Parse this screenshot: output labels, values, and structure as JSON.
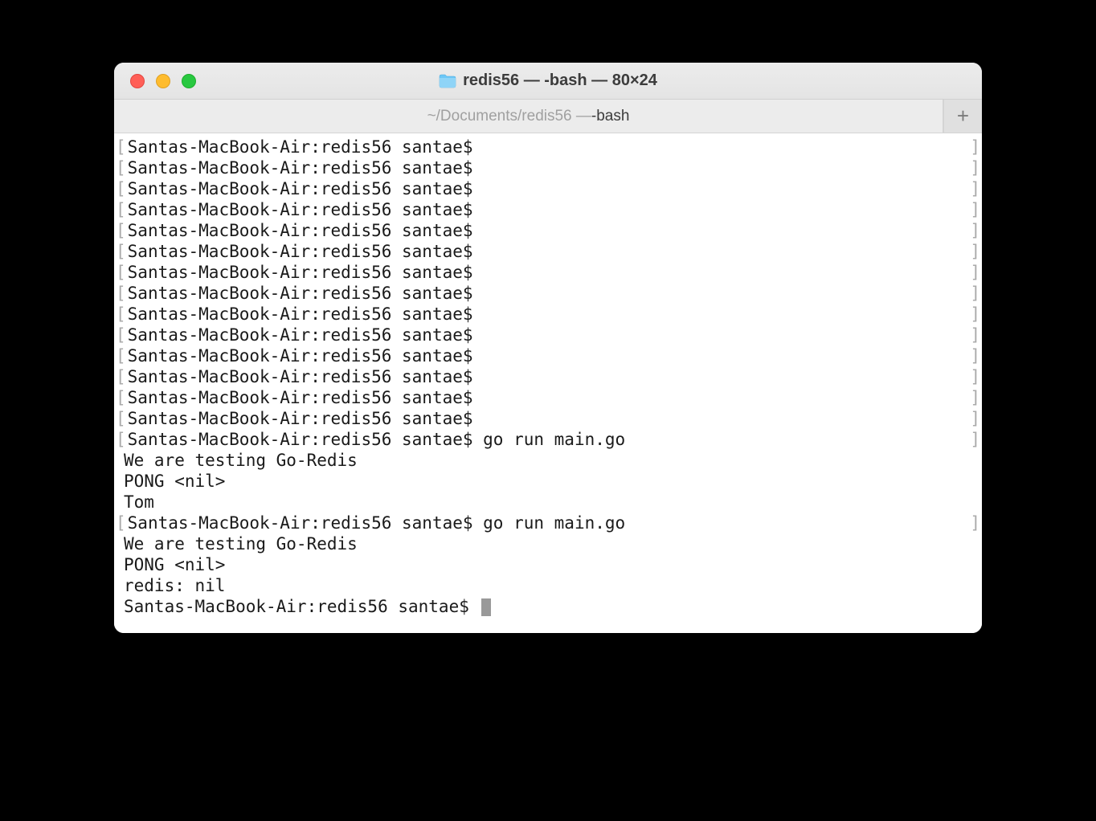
{
  "window": {
    "title": "redis56 — -bash — 80×24",
    "tab_path": "~/Documents/redis56 — ",
    "tab_shell": "-bash"
  },
  "terminal": {
    "prompt": "Santas-MacBook-Air:redis56 santae$ ",
    "empty_prompt_count": 14,
    "run1": {
      "cmd": "go run main.go",
      "out": [
        "We are testing Go-Redis",
        "PONG <nil>",
        "Tom"
      ]
    },
    "run2": {
      "cmd": "go run main.go",
      "out": [
        "We are testing Go-Redis",
        "PONG <nil>",
        "redis: nil"
      ]
    },
    "blank_line": "",
    "final_prompt": "Santas-MacBook-Air:redis56 santae$ "
  }
}
